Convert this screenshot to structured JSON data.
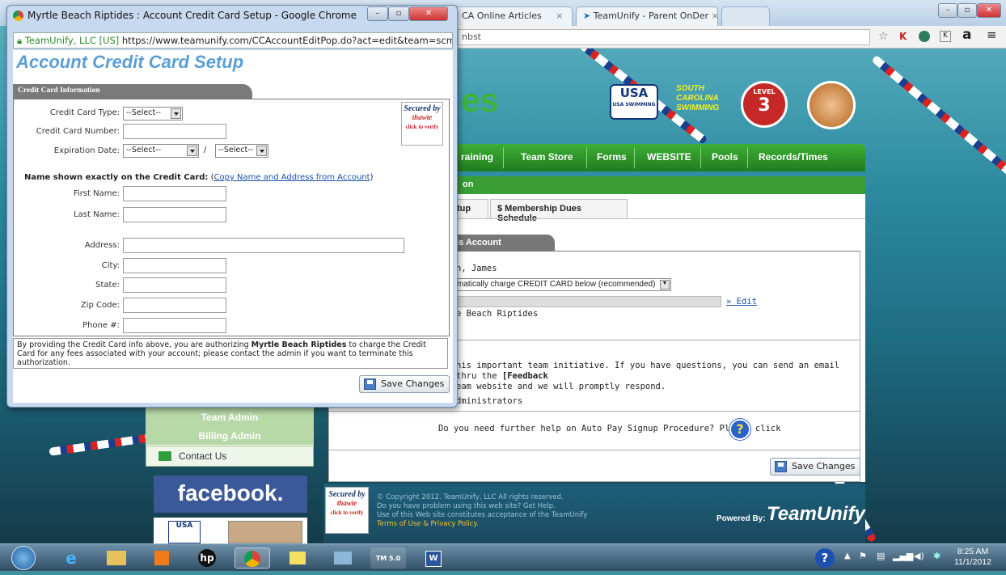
{
  "outer_browser": {
    "tabs": [
      "CA Online Articles",
      "TeamUnify - Parent OnDer"
    ],
    "address_fragment": "nbst"
  },
  "site": {
    "banner_title": "es",
    "banner_right_text": "SOUTH CAROLINA SWIMMING",
    "usa_swimming_label": "USA SWIMMING",
    "level_label": "LEVEL",
    "level_number": "3",
    "nav": [
      "raining",
      "Team Store",
      "Forms",
      "WEBSITE",
      "Pools",
      "Records/Times"
    ],
    "section_header": "on",
    "tabs": [
      "tup",
      "$ Membership Dues Schedule"
    ],
    "account_bar": "is Account",
    "account_name": "h, James",
    "autopay_option": "matically charge CREDIT CARD below (recommended)",
    "edit_link": "» Edit",
    "team_line": "e Beach Riptides",
    "initiative_text": "his important team initiative. If you have questions, you can send an email thru the ",
    "initiative_feedback": "[Feedback",
    "initiative_text2": "eam website and we will promptly respond.",
    "administrators": "dministrators",
    "help_text": "Do you need further help on Auto Pay Signup Procedure? Please click",
    "save_changes": "Save Changes",
    "sidebar": [
      "Team Admin",
      "Billing Admin",
      "Contact Us"
    ],
    "facebook": "facebook.",
    "footer_lines": [
      "© Copyright 2012. TeamUnify, LLC All rights reserved.",
      "Do you have problem using this web site? Get Help.",
      "Use of this Web site constitutes acceptance of the TeamUnify",
      "Terms of Use & Privacy Policy."
    ],
    "powered_by": "Powered By:",
    "teamunify": "TeamUnify",
    "secured_by": "Secured by",
    "thawte": "thawte",
    "click_to_verify": "click to verify"
  },
  "popup": {
    "window_title": "Myrtle Beach Riptides : Account Credit Card Setup - Google Chrome",
    "ssl_org": "TeamUnify, LLC [US]",
    "url": "https://www.teamunify.com/CCAccountEditPop.do?act=edit&team=scmbst&accoun",
    "heading": "Account Credit Card Setup",
    "section_tab": "Credit Card Information",
    "labels": {
      "cc_type": "Credit Card Type:",
      "cc_number": "Credit Card Number:",
      "expiration": "Expiration Date:",
      "first_name": "First Name:",
      "last_name": "Last Name:",
      "address": "Address:",
      "city": "City:",
      "state": "State:",
      "zip": "Zip Code:",
      "phone": "Phone #:"
    },
    "cc_type_value": "--Select--",
    "exp_month_value": "--Select--",
    "exp_year_value": "--Select--",
    "exp_separator": "/",
    "name_notice": "Name shown exactly on the Credit Card:",
    "copy_link": "Copy Name and Address from Account",
    "auth_text_1": "By providing the Credit Card info above, you are authorizing ",
    "auth_team": "Myrtle Beach Riptides",
    "auth_text_2": " to charge the Credit Card for any fees associated with your account; please contact the admin if you want to terminate this authorization.",
    "save_changes": "Save Changes"
  },
  "taskbar": {
    "tray_time": "8:25 AM",
    "tray_date": "11/1/2012"
  }
}
